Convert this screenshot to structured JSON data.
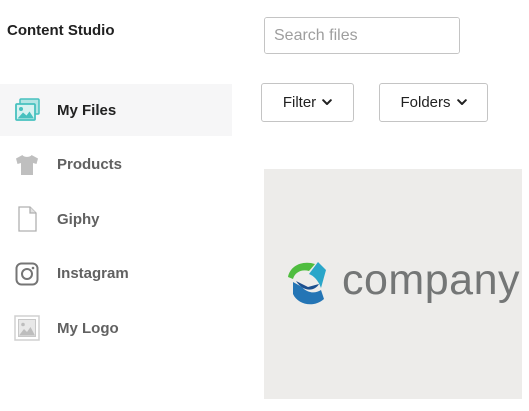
{
  "app": {
    "title": "Content Studio"
  },
  "sidebar": {
    "items": [
      {
        "label": "My Files",
        "icon": "image-gallery-icon",
        "active": true
      },
      {
        "label": "Products",
        "icon": "tshirt-icon",
        "active": false
      },
      {
        "label": "Giphy",
        "icon": "document-icon",
        "active": false
      },
      {
        "label": "Instagram",
        "icon": "instagram-icon",
        "active": false
      },
      {
        "label": "My Logo",
        "icon": "logo-image-icon",
        "active": false
      }
    ]
  },
  "search": {
    "placeholder": "Search files",
    "value": "",
    "button_icon": "search-icon"
  },
  "toolbar": {
    "filter_label": "Filter",
    "folders_label": "Folders"
  },
  "files": [
    {
      "thumbnail_text": "company",
      "logo_icon": "company-logo-mark"
    }
  ],
  "colors": {
    "active_bg": "#f6f6f7",
    "accent_teal": "#47c1bf",
    "tile_bg": "#edecea",
    "logo_green": "#4fbd3f",
    "logo_blue": "#2475b5",
    "logo_text": "#747676"
  }
}
